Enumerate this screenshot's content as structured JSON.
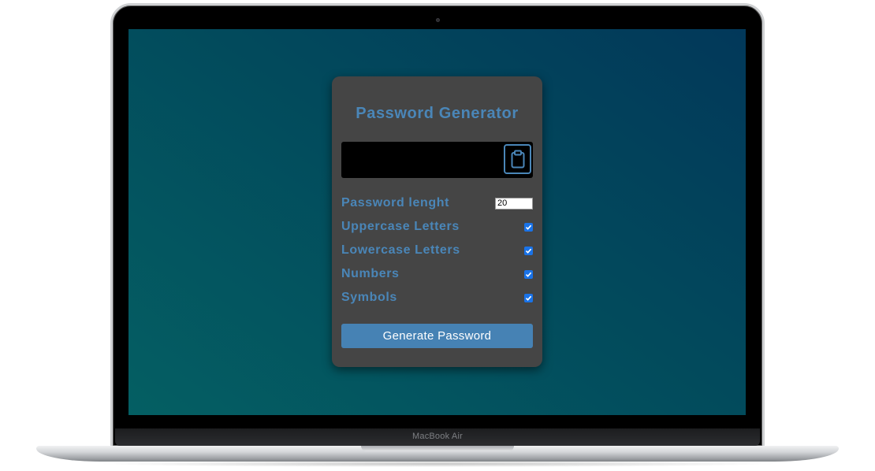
{
  "device": {
    "brand_label": "MacBook Air"
  },
  "app": {
    "title": "Password Generator",
    "result_value": "",
    "clipboard_icon": "clipboard-icon",
    "settings": [
      {
        "label": "Password lenght",
        "type": "number",
        "value": "20"
      },
      {
        "label": "Uppercase Letters",
        "type": "checkbox",
        "checked": true
      },
      {
        "label": "Lowercase Letters",
        "type": "checkbox",
        "checked": true
      },
      {
        "label": "Numbers",
        "type": "checkbox",
        "checked": true
      },
      {
        "label": "Symbols",
        "type": "checkbox",
        "checked": true
      }
    ],
    "generate_label": "Generate Password"
  },
  "colors": {
    "accent": "#4682b4",
    "card": "#454545",
    "screen_gradient": [
      "#045f63",
      "#02385a"
    ]
  }
}
